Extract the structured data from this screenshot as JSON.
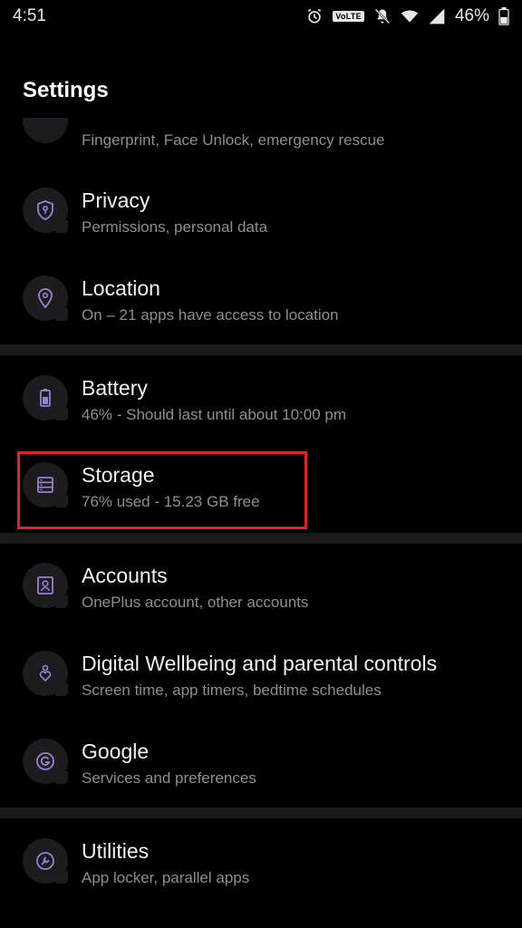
{
  "status_bar": {
    "time": "4:51",
    "volte": "VoLTE",
    "battery": "46%",
    "icons": [
      "alarm-icon",
      "mute-icon",
      "wifi-icon",
      "signal-icon"
    ]
  },
  "page": {
    "title": "Settings"
  },
  "partial_item": {
    "subtitle": "Fingerprint, Face Unlock, emergency rescue"
  },
  "items": [
    {
      "title": "Privacy",
      "subtitle": "Permissions, personal data",
      "icon": "shield-key-icon"
    },
    {
      "title": "Location",
      "subtitle": "On – 21 apps have access to location",
      "icon": "location-pin-icon"
    },
    {
      "title": "Battery",
      "subtitle": "46% - Should last until about 10:00 pm",
      "icon": "battery-icon"
    },
    {
      "title": "Storage",
      "subtitle": "76% used - 15.23 GB free",
      "icon": "storage-icon"
    },
    {
      "title": "Accounts",
      "subtitle": "OnePlus account, other accounts",
      "icon": "account-icon"
    },
    {
      "title": "Digital Wellbeing and parental controls",
      "subtitle": "Screen time, app timers, bedtime schedules",
      "icon": "heart-person-icon"
    },
    {
      "title": "Google",
      "subtitle": "Services and preferences",
      "icon": "google-icon"
    },
    {
      "title": "Utilities",
      "subtitle": "App locker, parallel apps",
      "icon": "utilities-icon"
    }
  ],
  "colors": {
    "accent": "#9b7fd4",
    "highlight": "#e0202a",
    "background": "#000000"
  }
}
